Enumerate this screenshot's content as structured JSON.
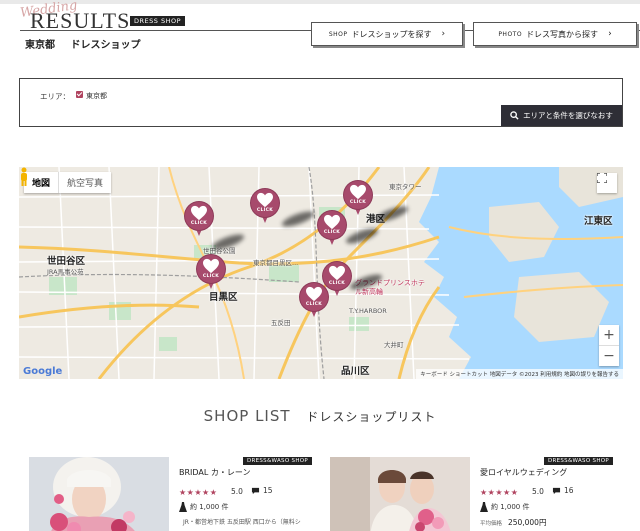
{
  "header": {
    "script_text": "Wedding",
    "title": "RESULTS",
    "badge": "DRESS SHOP",
    "subtitle_area": "東京都",
    "subtitle_type": "ドレスショップ"
  },
  "nav": {
    "shop_en": "SHOP",
    "shop_label": "ドレスショップを探す",
    "photo_en": "PHOTO",
    "photo_label": "ドレス写真から探す"
  },
  "area_search": {
    "label": "エリア：",
    "selected": "東京都",
    "button_label": "エリアと条件を選びなおす"
  },
  "map": {
    "tab_map": "地図",
    "tab_satellite": "航空写真",
    "marker_label": "CLICK",
    "labels": {
      "setagaya": "世田谷区",
      "jra": "JRA馬事公苑",
      "meguro": "目黒区",
      "minato": "港区",
      "koto": "江東区",
      "shinagawa": "品川区",
      "setagaya_park": "世田谷公園",
      "meguro_park": "東京都目黒区...",
      "hotel": "グランドプリンスホテル新高輪",
      "t_harbor": "T.Y.HARBOR",
      "tokyo_tower": "東京タワー",
      "gotanda": "五反田",
      "oimachi": "大井町"
    },
    "footer": "キーボード ショートカット   地図データ ©2023   利用規約   地図の誤りを報告する",
    "google": "Google"
  },
  "shop_list": {
    "title_en": "SHOP LIST",
    "title_ja": "ドレスショップリスト",
    "cards": [
      {
        "badge": "DRESS&WASO  SHOP",
        "name": "BRIDAL カ・レーン",
        "stars": "★★★★★",
        "score": "5.0",
        "comments": "15",
        "price": "約 1,000 件",
        "extra_label": "",
        "extra_value": "JR・都営地下鉄 五反田駅 西口から（無料シ"
      },
      {
        "badge": "DRESS&WASO  SHOP",
        "name": "愛ロイヤルウェディング",
        "stars": "★★★★★",
        "score": "5.0",
        "comments": "16",
        "price": "約 1,000 件",
        "extra_label": "平均価格",
        "extra_value": "250,000円"
      }
    ]
  },
  "colors": {
    "accent": "#a74a6c",
    "dark_button": "#2e2e36",
    "water": "#aadaff",
    "park": "#c8e6c9",
    "highway": "#f7c65d"
  }
}
